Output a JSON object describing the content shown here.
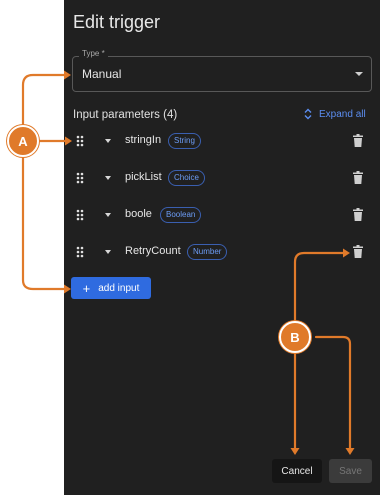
{
  "panel": {
    "title": "Edit trigger",
    "type_field": {
      "label": "Type *",
      "value": "Manual"
    },
    "params_title": "Input parameters (4)",
    "expand_all": "Expand all",
    "params": [
      {
        "name": "stringIn",
        "type": "String"
      },
      {
        "name": "pickList",
        "type": "Choice"
      },
      {
        "name": "boole",
        "type": "Boolean"
      },
      {
        "name": "RetryCount",
        "type": "Number"
      }
    ],
    "add_input": "add input",
    "cancel": "Cancel",
    "save": "Save"
  },
  "callouts": {
    "a": "A",
    "b": "B"
  },
  "colors": {
    "accent": "#2f6be0",
    "callout": "#e07a2a",
    "panel": "#202020"
  }
}
